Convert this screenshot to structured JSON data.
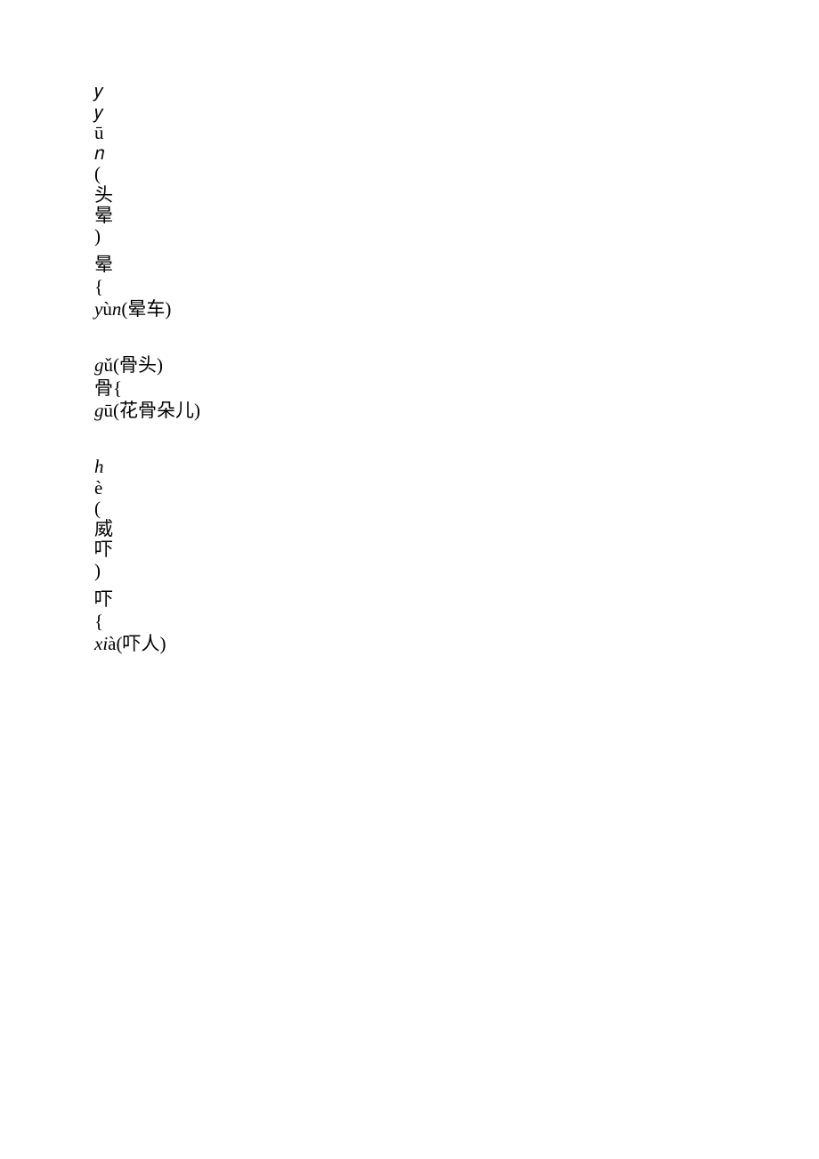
{
  "entries": [
    {
      "char": "晕",
      "top_prefix_vertical": [
        "𝑦",
        "ū",
        "𝑛",
        "",
        "(",
        "头",
        "晕",
        ")"
      ],
      "readings": [
        {
          "pinyin_italic": "y",
          "pinyin_rest": "ù",
          "pinyin_tail_italic": "n",
          "word": "(晕车)"
        }
      ]
    },
    {
      "char": "骨",
      "readings": [
        {
          "pinyin_italic": "g",
          "pinyin_rest": "ǔ",
          "pinyin_tail_italic": "",
          "word": "(骨头)"
        },
        {
          "pinyin_italic": "g",
          "pinyin_rest": "ū",
          "pinyin_tail_italic": "",
          "word": "(花骨朵儿)"
        }
      ]
    },
    {
      "char": "吓",
      "top_prefix_vertical": [
        "è",
        "(",
        "威",
        "吓",
        ")"
      ],
      "top_prefix_indent": "h",
      "readings": [
        {
          "pinyin_italic": "xi",
          "pinyin_rest": "à",
          "pinyin_tail_italic": "",
          "word": "(吓人)"
        }
      ]
    }
  ]
}
